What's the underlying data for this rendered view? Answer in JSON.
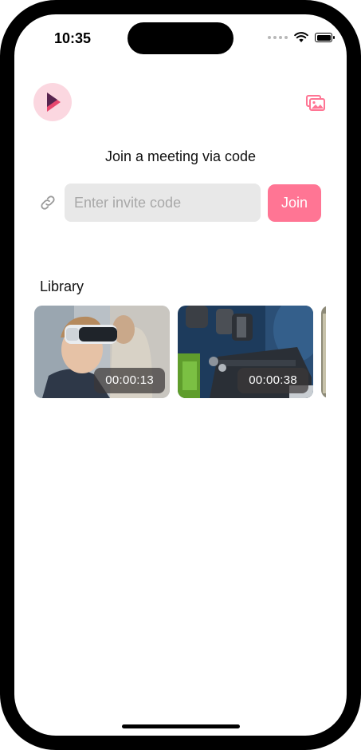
{
  "status_bar": {
    "time": "10:35"
  },
  "header": {
    "logo_icon": "play-logo-icon",
    "gallery_icon": "gallery-icon",
    "accent_color": "#ff7594"
  },
  "join": {
    "title": "Join a meeting via code",
    "input_placeholder": "Enter invite code",
    "input_value": "",
    "button_label": "Join"
  },
  "library": {
    "label": "Library",
    "items": [
      {
        "thumbnail": "child-with-vr-headset",
        "duration": "00:00:13"
      },
      {
        "thumbnail": "microscope",
        "duration": "00:00:38"
      },
      {
        "thumbnail": "partially-visible-video",
        "duration": ""
      }
    ]
  }
}
